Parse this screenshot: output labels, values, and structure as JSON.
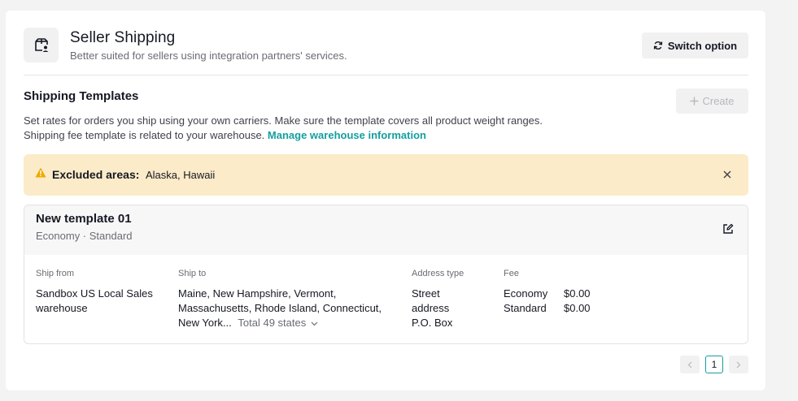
{
  "header": {
    "title": "Seller Shipping",
    "subtitle": "Better suited for sellers using integration partners' services.",
    "switch_label": "Switch option",
    "icon": "shipping-box-user-icon"
  },
  "templates_section": {
    "title": "Shipping Templates",
    "create_label": "Create",
    "description_line1": "Set rates for orders you ship using your own carriers. Make sure the template covers all product weight ranges.",
    "description_line2_prefix": "Shipping fee template is related to your warehouse.",
    "manage_link": "Manage warehouse information"
  },
  "alert": {
    "label": "Excluded areas:",
    "value": "Alaska, Hawaii"
  },
  "template": {
    "name": "New template 01",
    "meta": "Economy · Standard",
    "columns": {
      "ship_from": "Ship from",
      "ship_to": "Ship to",
      "address_type": "Address type",
      "fee": "Fee"
    },
    "ship_from_line1": "Sandbox US Local Sales",
    "ship_from_line2": "warehouse",
    "ship_to_line1": "Maine, New Hampshire, Vermont,",
    "ship_to_line2": "Massachusetts, Rhode Island, Connecticut,",
    "ship_to_line3": "New York...",
    "ship_to_total": "Total 49 states",
    "address_types": [
      "Street",
      "address",
      "P.O. Box"
    ],
    "fees": [
      {
        "name": "Economy",
        "amount": "$0.00"
      },
      {
        "name": "Standard",
        "amount": "$0.00"
      }
    ]
  },
  "pagination": {
    "current": "1"
  },
  "colors": {
    "accent": "#149ea0",
    "alert_bg": "#fcebc8",
    "warning": "#f0a800"
  }
}
